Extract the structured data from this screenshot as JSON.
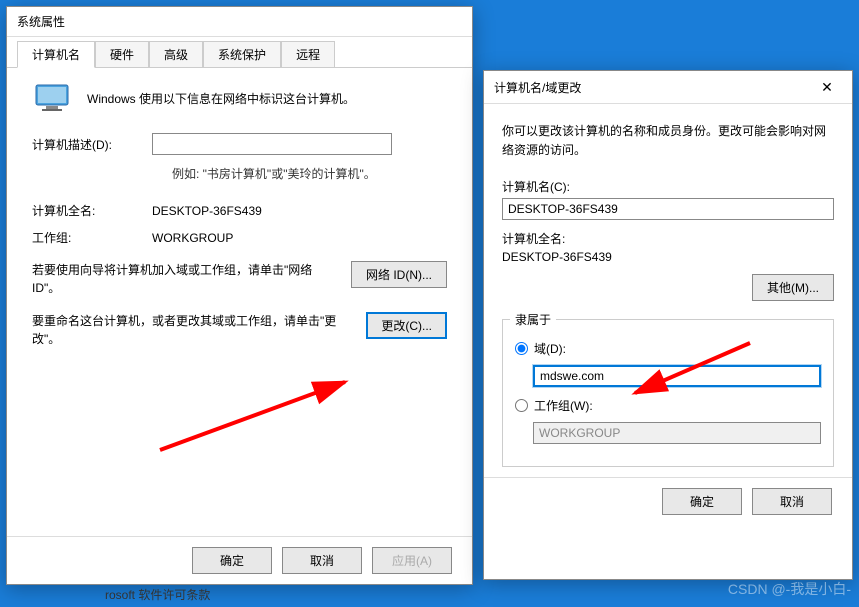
{
  "dialog1": {
    "title": "系统属性",
    "tabs": [
      "计算机名",
      "硬件",
      "高级",
      "系统保护",
      "远程"
    ],
    "intro": "Windows 使用以下信息在网络中标识这台计算机。",
    "desc_label": "计算机描述(D):",
    "desc_value": "",
    "example": "例如: \"书房计算机\"或\"美玲的计算机\"。",
    "fullname_label": "计算机全名:",
    "fullname_value": "DESKTOP-36FS439",
    "workgroup_label": "工作组:",
    "workgroup_value": "WORKGROUP",
    "netid_text": "若要使用向导将计算机加入域或工作组，请单击\"网络 ID\"。",
    "netid_btn": "网络 ID(N)...",
    "change_text": "要重命名这台计算机，或者更改其域或工作组，请单击\"更改\"。",
    "change_btn": "更改(C)...",
    "ok": "确定",
    "cancel": "取消",
    "apply": "应用(A)"
  },
  "dialog2": {
    "title": "计算机名/域更改",
    "close": "✕",
    "expl": "你可以更改该计算机的名称和成员身份。更改可能会影响对网络资源的访问。",
    "name_label": "计算机名(C):",
    "name_value": "DESKTOP-36FS439",
    "fullname_label": "计算机全名:",
    "fullname_value": "DESKTOP-36FS439",
    "other_btn": "其他(M)...",
    "member_legend": "隶属于",
    "domain_radio": "域(D):",
    "domain_value": "mdswe.com",
    "workgroup_radio": "工作组(W):",
    "workgroup_value": "WORKGROUP",
    "ok": "确定",
    "cancel": "取消"
  },
  "watermark": "CSDN @-我是小白-",
  "bottom_text": "rosoft 软件许可条款"
}
